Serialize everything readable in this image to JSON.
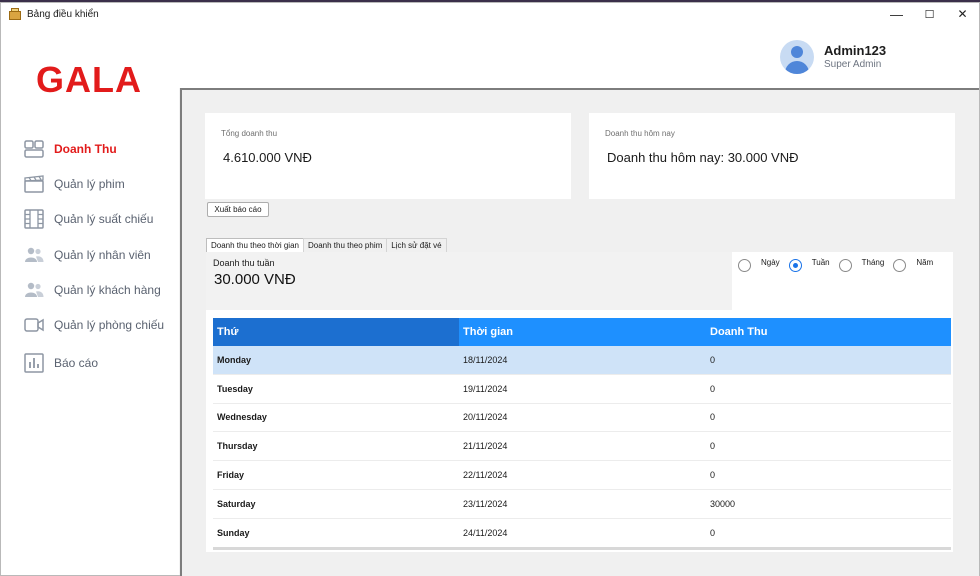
{
  "window": {
    "title": "Bảng điều khiển",
    "controls": {
      "minimize": "—",
      "maximize": "☐",
      "close": "✕"
    }
  },
  "sidebar": {
    "logo": "GALA",
    "items": [
      {
        "label": "Doanh Thu",
        "icon": "dashboard-icon",
        "active": true
      },
      {
        "label": "Quản lý phim",
        "icon": "clapperboard-icon",
        "active": false
      },
      {
        "label": "Quản lý suất chiếu",
        "icon": "film-strip-icon",
        "active": false
      },
      {
        "label": "Quản lý nhân viên",
        "icon": "people-icon",
        "active": false
      },
      {
        "label": "Quản lý khách hàng",
        "icon": "people-icon",
        "active": false
      },
      {
        "label": "Quản lý phòng chiếu",
        "icon": "video-camera-icon",
        "active": false
      },
      {
        "label": "Báo cáo",
        "icon": "bar-chart-icon",
        "active": false
      }
    ]
  },
  "header": {
    "username": "Admin123",
    "role": "Super Admin"
  },
  "cards": {
    "total": {
      "caption": "Tổng doanh thu",
      "value": "4.610.000 VNĐ"
    },
    "today": {
      "caption": "Doanh thu hôm nay",
      "value": "Doanh thu hôm nay: 30.000 VNĐ"
    }
  },
  "export_button": "Xuất báo cáo",
  "tabs": [
    {
      "label": "Doanh thu theo thời gian",
      "active": true
    },
    {
      "label": "Doanh thu theo phim",
      "active": false
    },
    {
      "label": "Lịch sử đặt vé",
      "active": false
    }
  ],
  "period": {
    "caption": "Doanh thu tuần",
    "value": "30.000 VNĐ",
    "options": [
      {
        "label": "Ngày",
        "checked": false
      },
      {
        "label": "Tuần",
        "checked": true
      },
      {
        "label": "Tháng",
        "checked": false
      },
      {
        "label": "Năm",
        "checked": false
      }
    ]
  },
  "table": {
    "columns": [
      "Thứ",
      "Thời gian",
      "Doanh Thu"
    ],
    "rows": [
      [
        "Monday",
        "18/11/2024",
        "0"
      ],
      [
        "Tuesday",
        "19/11/2024",
        "0"
      ],
      [
        "Wednesday",
        "20/11/2024",
        "0"
      ],
      [
        "Thursday",
        "21/11/2024",
        "0"
      ],
      [
        "Friday",
        "22/11/2024",
        "0"
      ],
      [
        "Saturday",
        "23/11/2024",
        "30000"
      ],
      [
        "Sunday",
        "24/11/2024",
        "0"
      ]
    ],
    "selected_row": 0
  },
  "colors": {
    "brand": "#e21b1b",
    "header_blue": "#1e90ff",
    "selected_row": "#cfe3f8",
    "nav_text": "#5a6270"
  }
}
